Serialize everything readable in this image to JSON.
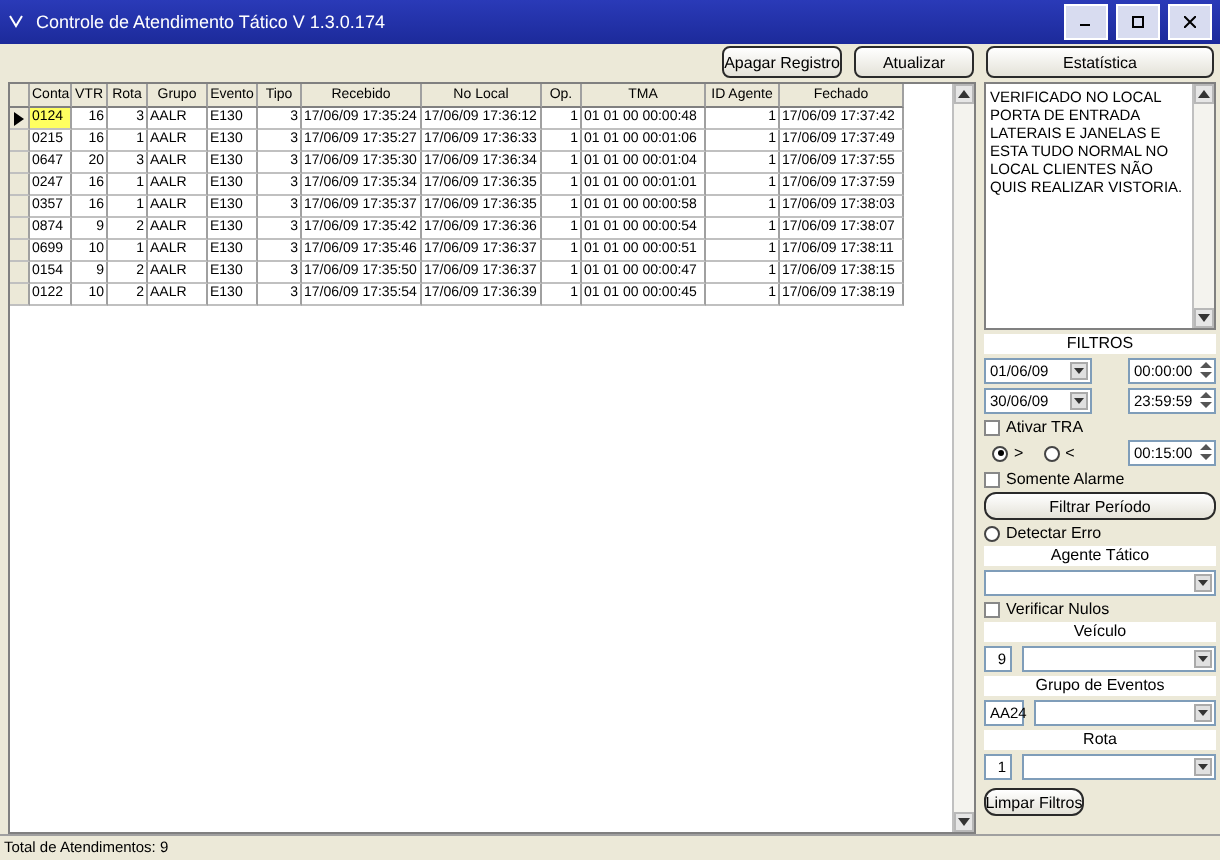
{
  "window": {
    "title": "Controle de Atendimento Tático V 1.3.0.174"
  },
  "toolbar": {
    "buttons": [
      "Apagar Registro",
      "Atualizar",
      "Estatística"
    ]
  },
  "table": {
    "columns": [
      "Conta",
      "VTR",
      "Rota",
      "Grupo",
      "Evento",
      "Tipo",
      "Recebido",
      "No Local",
      "Op.",
      "TMA",
      "ID Agente",
      "Fechado"
    ],
    "rows": [
      {
        "selected": true,
        "cells": [
          "0124",
          "16",
          "3",
          "AALR",
          "E130",
          "3",
          "17/06/09 17:35:24",
          "17/06/09 17:36:12",
          "1",
          "01 01 00 00:00:48",
          "1",
          "17/06/09 17:37:42"
        ]
      },
      {
        "selected": false,
        "cells": [
          "0215",
          "16",
          "1",
          "AALR",
          "E130",
          "3",
          "17/06/09 17:35:27",
          "17/06/09 17:36:33",
          "1",
          "01 01 00 00:01:06",
          "1",
          "17/06/09 17:37:49"
        ]
      },
      {
        "selected": false,
        "cells": [
          "0647",
          "20",
          "3",
          "AALR",
          "E130",
          "3",
          "17/06/09 17:35:30",
          "17/06/09 17:36:34",
          "1",
          "01 01 00 00:01:04",
          "1",
          "17/06/09 17:37:55"
        ]
      },
      {
        "selected": false,
        "cells": [
          "0247",
          "16",
          "1",
          "AALR",
          "E130",
          "3",
          "17/06/09 17:35:34",
          "17/06/09 17:36:35",
          "1",
          "01 01 00 00:01:01",
          "1",
          "17/06/09 17:37:59"
        ]
      },
      {
        "selected": false,
        "cells": [
          "0357",
          "16",
          "1",
          "AALR",
          "E130",
          "3",
          "17/06/09 17:35:37",
          "17/06/09 17:36:35",
          "1",
          "01 01 00 00:00:58",
          "1",
          "17/06/09 17:38:03"
        ]
      },
      {
        "selected": false,
        "cells": [
          "0874",
          "9",
          "2",
          "AALR",
          "E130",
          "3",
          "17/06/09 17:35:42",
          "17/06/09 17:36:36",
          "1",
          "01 01 00 00:00:54",
          "1",
          "17/06/09 17:38:07"
        ]
      },
      {
        "selected": false,
        "cells": [
          "0699",
          "10",
          "1",
          "AALR",
          "E130",
          "3",
          "17/06/09 17:35:46",
          "17/06/09 17:36:37",
          "1",
          "01 01 00 00:00:51",
          "1",
          "17/06/09 17:38:11"
        ]
      },
      {
        "selected": false,
        "cells": [
          "0154",
          "9",
          "2",
          "AALR",
          "E130",
          "3",
          "17/06/09 17:35:50",
          "17/06/09 17:36:37",
          "1",
          "01 01 00 00:00:47",
          "1",
          "17/06/09 17:38:15"
        ]
      },
      {
        "selected": false,
        "cells": [
          "0122",
          "10",
          "2",
          "AALR",
          "E130",
          "3",
          "17/06/09 17:35:54",
          "17/06/09 17:36:39",
          "1",
          "01 01 00 00:00:45",
          "1",
          "17/06/09 17:38:19"
        ]
      }
    ]
  },
  "panel": {
    "memo": "VERIFICADO NO LOCAL PORTA DE ENTRADA LATERAIS E JANELAS E ESTA TUDO NORMAL NO LOCAL CLIENTES NÃO QUIS REALIZAR VISTORIA.",
    "filters_title": "FILTROS",
    "date_from": "01/06/09",
    "time_from": "00:00:00",
    "date_to": "30/06/09",
    "time_to": "23:59:59",
    "ativar_tra": {
      "label": "Ativar TRA",
      "checked": false
    },
    "comparators": [
      {
        "label": ">",
        "selected": true
      },
      {
        "label": "<",
        "selected": false
      }
    ],
    "tra_time": "00:15:00",
    "somente_alarme": {
      "label": "Somente Alarme",
      "checked": false
    },
    "filter_button": "Filtrar Período",
    "detectar_erro": {
      "label": "Detectar Erro",
      "selected": false
    },
    "agente_label": "Agente Tático",
    "verificar_nulos": {
      "label": "Verificar Nulos",
      "checked": false
    },
    "veiculo_label": "Veículo",
    "veiculo_value": "9",
    "grupo_label": "Grupo de Eventos",
    "grupo_value": "AA24",
    "rota_label": "Rota",
    "rota_value": "1",
    "clear_button": "Limpar Filtros"
  },
  "status_bar": "Total de Atendimentos: 9"
}
